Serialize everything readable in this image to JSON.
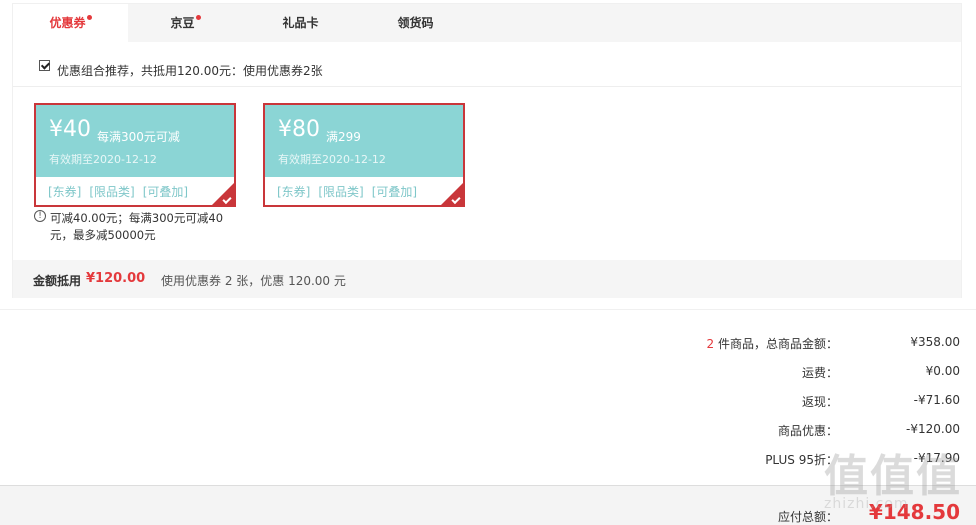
{
  "tabs": [
    {
      "label": "优惠券",
      "dot": true
    },
    {
      "label": "京豆",
      "dot": true
    },
    {
      "label": "礼品卡",
      "dot": false
    },
    {
      "label": "领货码",
      "dot": false
    }
  ],
  "combo": {
    "checked": true,
    "text": "优惠组合推荐，共抵用120.00元：使用优惠券2张"
  },
  "coupons": [
    {
      "amount": "¥40",
      "condition": "每满300元可减",
      "expire": "有效期至2020-12-12",
      "tags": [
        "[东券]",
        "[限品类]",
        "[可叠加]"
      ],
      "selected": true
    },
    {
      "amount": "¥80",
      "condition": "满299",
      "expire": "有效期至2020-12-12",
      "tags": [
        "[东券]",
        "[限品类]",
        "[可叠加]"
      ],
      "selected": true
    }
  ],
  "coupon_note": "可减40.00元；每满300元可减40元，最多减50000元",
  "summary": {
    "label": "金额抵用",
    "amount": "¥120.00",
    "desc": "使用优惠券 2 张，优惠 120.00 元"
  },
  "totals": {
    "goods_count": "2",
    "goods_label": "件商品，总商品金额：",
    "goods_amount": "¥358.00",
    "shipping_label": "运费：",
    "shipping_amount": "¥0.00",
    "cashback_label": "返现：",
    "cashback_amount": "-¥71.60",
    "discount_label": "商品优惠：",
    "discount_amount": "-¥120.00",
    "plus_label": "PLUS 95折：",
    "plus_amount": "-¥17.90"
  },
  "pay": {
    "label": "应付总额：",
    "amount": "¥148.50"
  },
  "watermark": {
    "glyphs": "值值值",
    "url": "zhizhi.com"
  },
  "colors": {
    "accent": "#e4393c",
    "coupon_bg": "#8bd5d5",
    "coupon_border": "#c9363a"
  },
  "icons": {
    "info": "info-icon",
    "check": "check-icon"
  }
}
